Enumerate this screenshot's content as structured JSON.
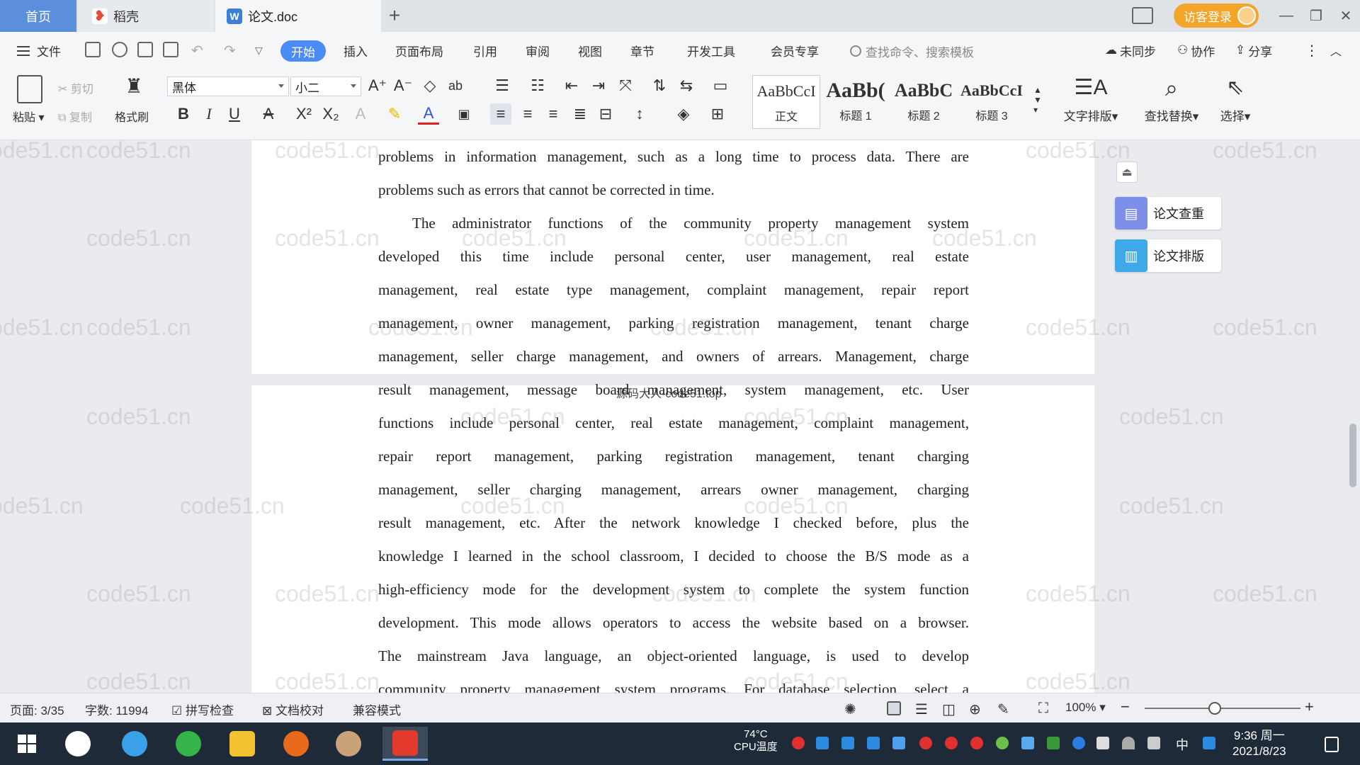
{
  "tabs": {
    "home": "首页",
    "daoke": "稻壳",
    "doc": "论文.doc",
    "add": "+"
  },
  "titlebar": {
    "visitor_login": "访客登录",
    "min": "—",
    "restore": "❐",
    "close": "✕"
  },
  "menu": {
    "file": "文件",
    "start": "开始",
    "insert": "插入",
    "page_layout": "页面布局",
    "references": "引用",
    "review": "审阅",
    "view": "视图",
    "chapter": "章节",
    "dev_tools": "开发工具",
    "member": "会员专享",
    "search_placeholder": "查找命令、搜索模板",
    "not_synced": "未同步",
    "collaborate": "协作",
    "share": "分享"
  },
  "ribbon": {
    "paste": "粘贴",
    "cut": "剪切",
    "copy": "复制",
    "format_painter": "格式刷",
    "font_name": "黑体",
    "font_size": "小二",
    "styles": [
      {
        "sample": "AaBbCcI",
        "name": "正文"
      },
      {
        "sample": "AaBb(",
        "name": "标题 1"
      },
      {
        "sample": "AaBbC",
        "name": "标题 2"
      },
      {
        "sample": "AaBbCcI",
        "name": "标题 3"
      }
    ],
    "text_layout": "文字排版",
    "find_replace": "查找替换",
    "select": "选择"
  },
  "document": {
    "lines": [
      "problems in information management, such as a long time to process data. There are",
      "problems such as errors that cannot be corrected in time.",
      "The administrator functions of the community property management system",
      "developed this time include personal center, user management, real estate",
      "management, real estate type management, complaint management, repair report",
      "management, owner management, parking registration management, tenant charge",
      "management, seller charge management, and owners of arrears. Management, charge",
      "result management, message board management, system management, etc. User",
      "functions include personal center, real estate management, complaint management,",
      "repair report management, parking registration management, tenant charging",
      "management, seller charging management, arrears owner management, charging",
      "result management, etc. After the network knowledge I checked before, plus the",
      "knowledge I learned in the school classroom, I decided to choose the B/S mode as a",
      "high-efficiency mode for the development system to complete the system function",
      "development. This mode allows operators to access the website based on a browser.",
      "The mainstream Java language, an object-oriented language, is used to develop",
      "community property management system programs. For database selection, select a"
    ],
    "page_footer": "源码大人-code51.top",
    "watermark": "code51.cn"
  },
  "side_tools": {
    "check": "论文查重",
    "layout": "论文排版"
  },
  "status": {
    "page": "页面: 3/35",
    "words": "字数: 11994",
    "spell_check": "拼写检查",
    "doc_proof": "文档校对",
    "compat_mode": "兼容模式",
    "zoom": "100%",
    "zoom_level_percent": 100
  },
  "taskbar": {
    "cpu_temp": "74°C",
    "cpu_label": "CPU温度",
    "ime": "中",
    "time": "9:36 周一",
    "date": "2021/8/23"
  },
  "colors": {
    "accent": "#4a8bf5",
    "home_tab": "#5b8fde",
    "visitor": "#f3a52a",
    "taskbar": "#1e2a38"
  }
}
